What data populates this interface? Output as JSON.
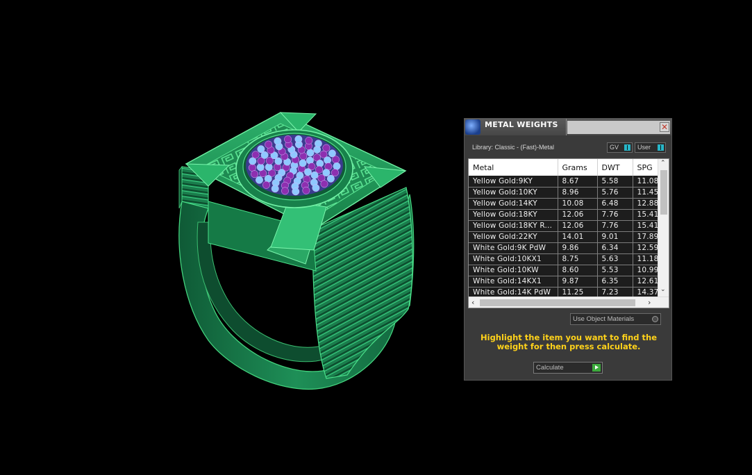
{
  "panel": {
    "title": "METAL WEIGHTS",
    "close_glyph": "✕",
    "library_label": "Library: Classic - (Fast)-Metal",
    "toggles": {
      "gv": "GV",
      "user": "User"
    },
    "table": {
      "headers": [
        "Metal",
        "Grams",
        "DWT",
        "SPG"
      ],
      "rows": [
        [
          "Yellow Gold:9KY",
          "8.67",
          "5.58",
          "11.08"
        ],
        [
          "Yellow Gold:10KY",
          "8.96",
          "5.76",
          "11.45"
        ],
        [
          "Yellow Gold:14KY",
          "10.08",
          "6.48",
          "12.88"
        ],
        [
          "Yellow Gold:18KY",
          "12.06",
          "7.76",
          "15.41"
        ],
        [
          "Yellow Gold:18KY R...",
          "12.06",
          "7.76",
          "15.41"
        ],
        [
          "Yellow Gold:22KY",
          "14.01",
          "9.01",
          "17.89"
        ],
        [
          "White Gold:9K PdW",
          "9.86",
          "6.34",
          "12.59"
        ],
        [
          "White Gold:10KX1",
          "8.75",
          "5.63",
          "11.18"
        ],
        [
          "White Gold:10KW",
          "8.60",
          "5.53",
          "10.99"
        ],
        [
          "White Gold:14KX1",
          "9.87",
          "6.35",
          "12.61"
        ],
        [
          "White Gold:14K PdW",
          "11.25",
          "7.23",
          "14.37"
        ]
      ]
    },
    "use_object_materials": "Use Object Materials",
    "instruction": "Highlight the item you want to find the weight for then press calculate.",
    "calculate": "Calculate"
  },
  "colors": {
    "metal_green": "#1f8a55",
    "metal_edge": "#5cf08a",
    "gem_purple": "#8d2fb0",
    "gem_blue": "#8fc8ff",
    "instruction_yellow": "#ffd21a",
    "go_green": "#3caa3c"
  },
  "icons": {
    "app_logo": "matrix-logo-icon",
    "close": "close-icon",
    "scroll_up": "scroll-up-icon",
    "scroll_down": "scroll-down-icon",
    "scroll_left": "scroll-left-icon",
    "scroll_right": "scroll-right-icon",
    "go": "play-arrow-icon"
  }
}
